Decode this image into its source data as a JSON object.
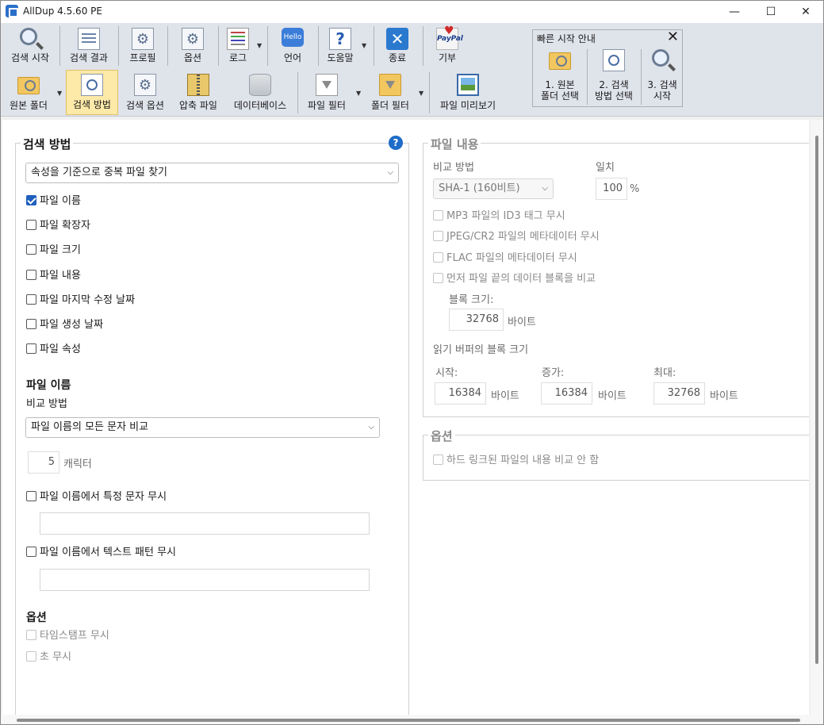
{
  "window": {
    "title": "AllDup 4.5.60 PE",
    "controls": {
      "minimize": "—",
      "maximize": "☐",
      "close": "✕"
    }
  },
  "toolbar1": {
    "start_search": "검색 시작",
    "search_results": "검색 결과",
    "profiles": "프로필",
    "options": "옵션",
    "log": "로그",
    "language": "언어",
    "language_icon_text": "Hello",
    "help": "도움말",
    "help_icon_text": "?",
    "exit": "종료",
    "exit_icon_text": "✕",
    "donate": "기부",
    "donate_icon_text": "PayPal"
  },
  "toolbar2": {
    "source_folder": "원본 폴더",
    "search_method": "검색 방법",
    "search_options": "검색 옵션",
    "archive_files": "압축 파일",
    "database": "데이터베이스",
    "file_filter": "파일 필터",
    "folder_filter": "폴더 필터",
    "file_preview": "파일 미리보기"
  },
  "quick_start": {
    "title": "빠른 시작 안내",
    "close": "✕",
    "step1_line1": "1. 원본",
    "step1_line2": "폴더 선택",
    "step2_line1": "2. 검색",
    "step2_line2": "방법 선택",
    "step3_line1": "3. 검색",
    "step3_line2": "시작"
  },
  "search_method": {
    "group_title": "검색 방법",
    "help_icon_text": "?",
    "mode_selected": "속성을 기준으로 중복 파일 찾기",
    "attributes": [
      {
        "label": "파일 이름",
        "checked": true
      },
      {
        "label": "파일 확장자",
        "checked": false
      },
      {
        "label": "파일 크기",
        "checked": false
      },
      {
        "label": "파일 내용",
        "checked": false
      },
      {
        "label": "파일 마지막 수정 날짜",
        "checked": false
      },
      {
        "label": "파일 생성 날짜",
        "checked": false
      },
      {
        "label": "파일 속성",
        "checked": false
      }
    ],
    "file_name_section_title": "파일 이름",
    "compare_method_label": "비교 방법",
    "compare_method_selected": "파일 이름의 모든 문자 비교",
    "char_count_value": "5",
    "char_count_unit": "캐릭터",
    "ignore_chars_label": "파일 이름에서 특정 문자 무시",
    "ignore_chars_value": "",
    "ignore_pattern_label": "파일 이름에서 텍스트 패턴 무시",
    "ignore_pattern_value": "",
    "options_title": "옵션",
    "ignore_timestamp_label": "타임스탬프 무시",
    "ignore_seconds_label": "초 무시"
  },
  "file_content": {
    "group_title": "파일 내용",
    "compare_method_label": "비교 방법",
    "compare_method_selected": "SHA-1 (160비트)",
    "match_label": "일치",
    "match_value": "100",
    "match_unit": "%",
    "mp3_label": "MP3 파일의 ID3 태그 무시",
    "jpeg_label": "JPEG/CR2 파일의 메타데이터 무시",
    "flac_label": "FLAC 파일의 메타데이터 무시",
    "tail_label": "먼저 파일 끝의 데이터 블록을 비교",
    "block_size_label": "블록 크기:",
    "block_size_value": "32768",
    "bytes_unit": "바이트",
    "read_buffer_label": "읽기 버퍼의 블록 크기",
    "start_label": "시작:",
    "start_value": "16384",
    "increment_label": "증가:",
    "increment_value": "16384",
    "max_label": "최대:",
    "max_value": "32768"
  },
  "options_group": {
    "group_title": "옵션",
    "hardlink_label": "하드 링크된 파일의 내용 비교 안 함"
  },
  "colors": {
    "toolbar_bg": "#dfe3ea",
    "active_button": "#fde9a8",
    "checkbox_checked": "#1e5fbf",
    "help_icon": "#1e6cc8"
  }
}
